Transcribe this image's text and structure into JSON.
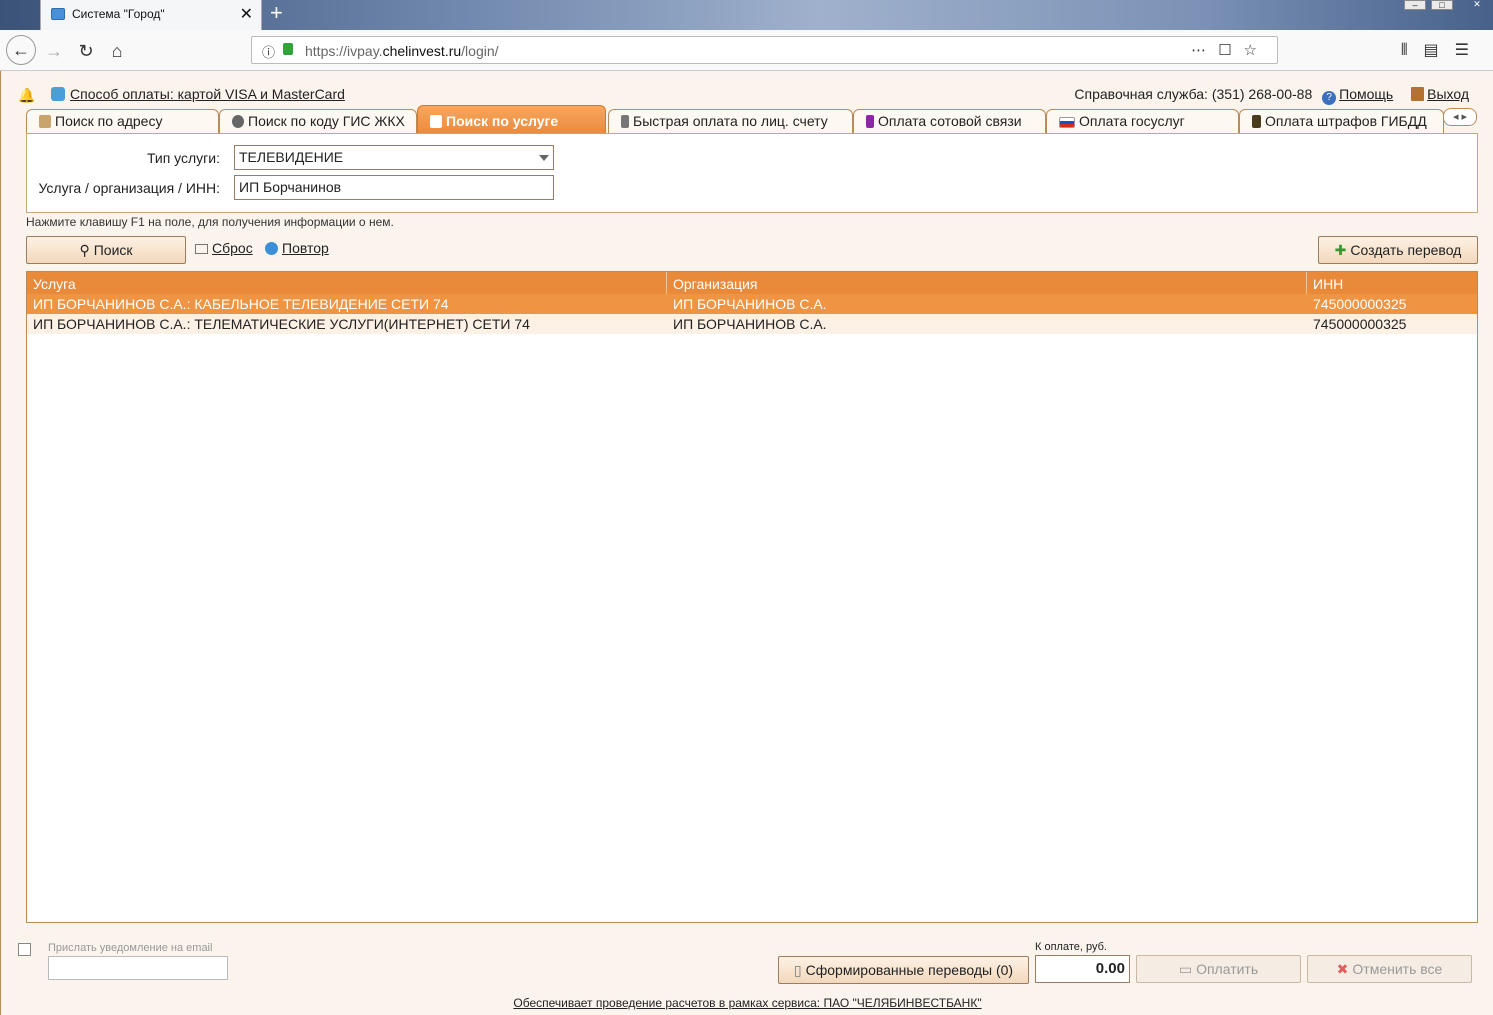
{
  "browser": {
    "tab_title": "Система \"Город\"",
    "url_prefix": "https://ivpay.",
    "url_domain": "chelinvest.ru",
    "url_path": "/login/"
  },
  "header": {
    "payment_method": "Способ оплаты: картой VISA и MasterCard",
    "helpdesk": "Справочная служба: (351) 268-00-88",
    "help_link": "Помощь",
    "exit_link": "Выход"
  },
  "tabs": [
    {
      "label": "Поиск по адресу",
      "icon": "book-icon",
      "color": "#8a6d3b"
    },
    {
      "label": "Поиск по коду ГИС ЖКХ",
      "icon": "gis-icon",
      "color": "#555555"
    },
    {
      "label": "Поиск по услуге",
      "icon": "bell-service-icon",
      "color": "#ffffff"
    },
    {
      "label": "Быстрая оплата по лиц. счету",
      "icon": "phone-card-icon",
      "color": "#6a6a6a"
    },
    {
      "label": "Оплата сотовой связи",
      "icon": "mobile-icon",
      "color": "#7b1fa2"
    },
    {
      "label": "Оплата госуслуг",
      "icon": "russia-flag-icon",
      "color": "#1e4fbf"
    },
    {
      "label": "Оплата штрафов ГИБДД",
      "icon": "traffic-light-icon",
      "color": "#4a3b1d"
    }
  ],
  "form": {
    "service_type_label": "Тип услуги:",
    "service_type_value": "ТЕЛЕВИДЕНИЕ",
    "org_label": "Услуга / организация / ИНН:",
    "org_value": "ИП Борчанинов",
    "hint": "Нажмите клавишу F1 на поле, для получения информации о нем."
  },
  "actions": {
    "search": "Поиск",
    "reset": "Сброс",
    "repeat": "Повтор",
    "create_transfer": "Создать перевод"
  },
  "grid": {
    "columns": [
      "Услуга",
      "Организация",
      "ИНН"
    ],
    "rows": [
      [
        "ИП БОРЧАНИНОВ С.А.: КАБЕЛЬНОЕ ТЕЛЕВИДЕНИЕ СЕТИ 74",
        "ИП БОРЧАНИНОВ С.А.",
        "745000000325"
      ],
      [
        "ИП БОРЧАНИНОВ С.А.: ТЕЛЕМАТИЧЕСКИЕ УСЛУГИ(ИНТЕРНЕТ) СЕТИ 74",
        "ИП БОРЧАНИНОВ С.А.",
        "745000000325"
      ]
    ]
  },
  "footer": {
    "notify_label": "Прислать уведомление на email",
    "formed_transfers": "Сформированные переводы (0)",
    "to_pay_label": "К оплате, руб.",
    "to_pay_value": "0.00",
    "pay_button": "Оплатить",
    "cancel_all": "Отменить все",
    "note": "Обеспечивает проведение расчетов в рамках сервиса: ПАО \"ЧЕЛЯБИНВЕСТБАНК\""
  },
  "colors": {
    "accent": "#e98a3a",
    "selected_row": "#ef9442",
    "page_bg": "#fbf4ec"
  }
}
